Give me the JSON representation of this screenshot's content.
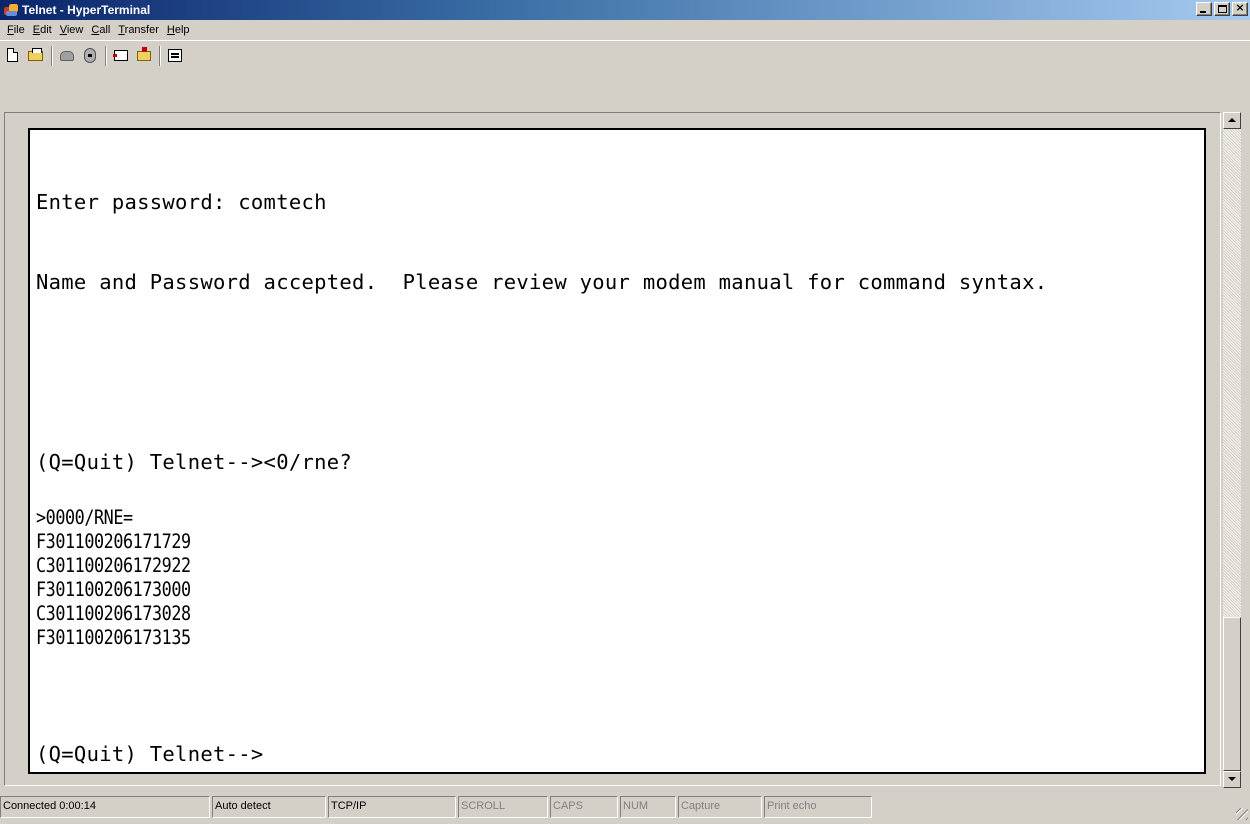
{
  "window": {
    "title": "Telnet - HyperTerminal"
  },
  "menu": [
    {
      "label": "File",
      "accel": "F",
      "rest": "ile"
    },
    {
      "label": "Edit",
      "accel": "E",
      "rest": "dit"
    },
    {
      "label": "View",
      "accel": "V",
      "rest": "iew"
    },
    {
      "label": "Call",
      "accel": "C",
      "rest": "all"
    },
    {
      "label": "Transfer",
      "accel": "T",
      "rest": "ransfer"
    },
    {
      "label": "Help",
      "accel": "H",
      "rest": "elp"
    }
  ],
  "toolbar": {
    "icons": [
      "new-icon",
      "open-icon",
      "call-icon",
      "disconnect-icon",
      "send-icon",
      "receive-icon",
      "properties-icon"
    ]
  },
  "terminal": {
    "lines": [
      {
        "text": "Enter password: comtech",
        "size": "big"
      },
      {
        "text": "Name and Password accepted.  Please review your modem manual for command syntax.",
        "size": "big"
      },
      {
        "text": "(Q=Quit) Telnet--><0/rne?",
        "size": "big"
      },
      {
        "text": ">0000/RNE=",
        "size": "small"
      },
      {
        "text": "F301100206171729",
        "size": "small"
      },
      {
        "text": "C301100206172922",
        "size": "small"
      },
      {
        "text": "F301100206173000",
        "size": "small"
      },
      {
        "text": "C301100206173028",
        "size": "small"
      },
      {
        "text": "F301100206173135",
        "size": "small"
      },
      {
        "text": "(Q=Quit) Telnet-->",
        "size": "big"
      }
    ]
  },
  "statusbar": {
    "connected": "Connected 0:00:14",
    "detect": "Auto detect",
    "protocol": "TCP/IP",
    "scroll": "SCROLL",
    "caps": "CAPS",
    "num": "NUM",
    "capture": "Capture",
    "print_echo": "Print echo"
  },
  "colors": {
    "titlebar_start": "#0a246a",
    "titlebar_end": "#a6caf0",
    "chrome": "#d4d0c8",
    "screen_bg": "#ffffff"
  }
}
